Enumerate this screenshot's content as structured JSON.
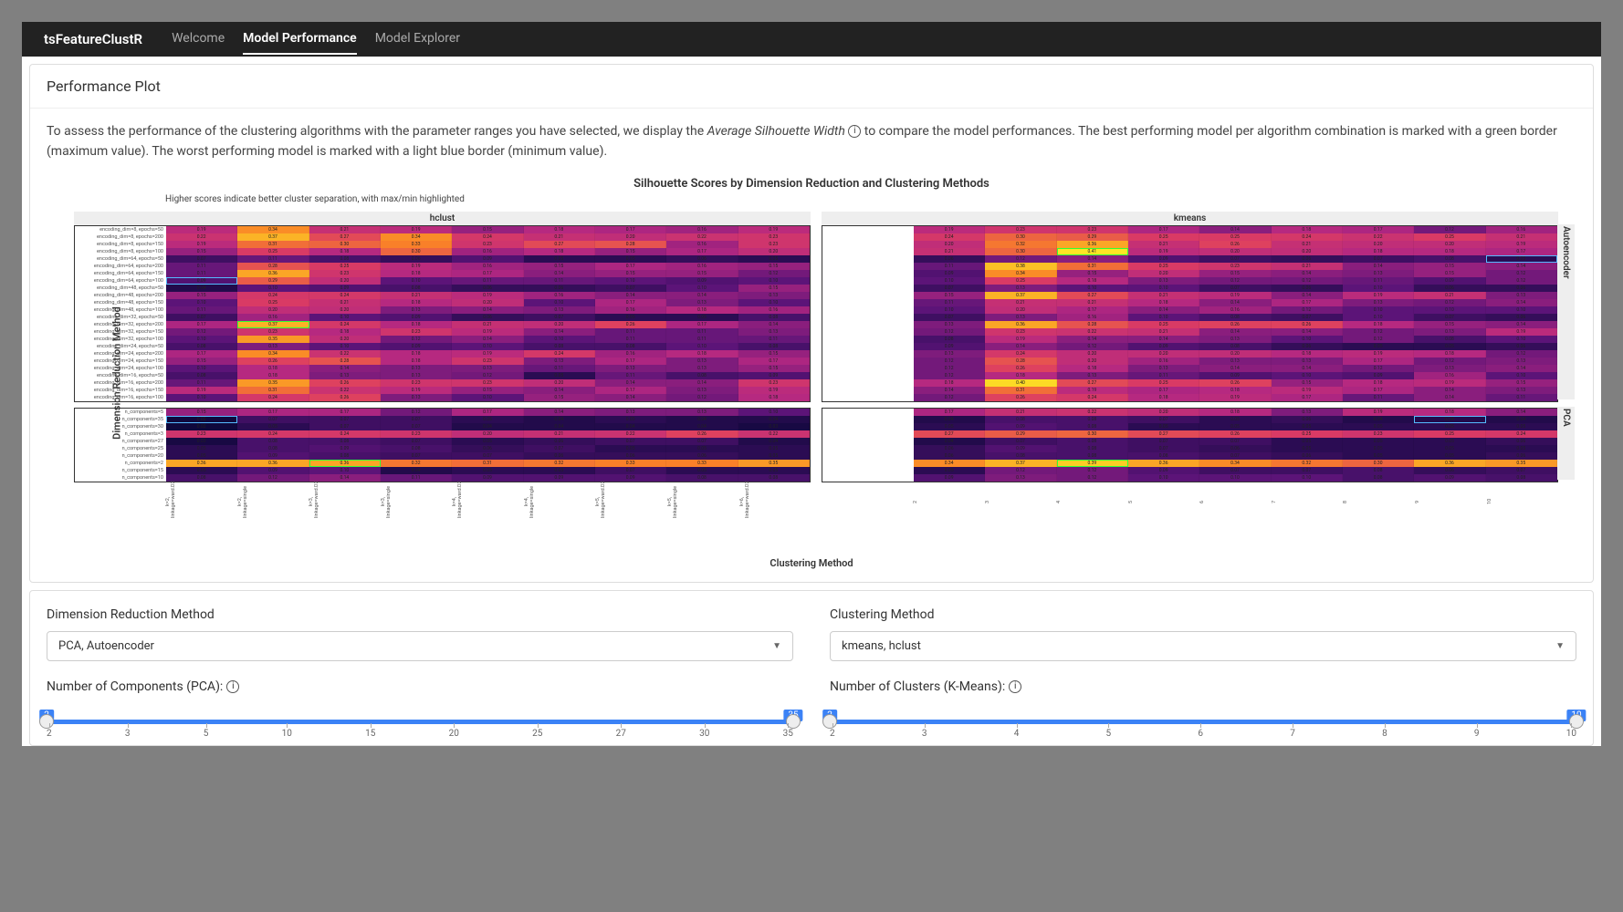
{
  "brand": "tsFeatureClustR",
  "nav": {
    "items": [
      "Welcome",
      "Model Performance",
      "Model Explorer"
    ],
    "active": 1
  },
  "panel": {
    "title": "Performance Plot",
    "desc_pre": "To assess the performance of the clustering algorithms with the parameter ranges you have selected, we display the ",
    "desc_em": "Average Silhouette Width",
    "desc_post": " to compare the model performances. The best performing model per algorithm combination is marked with a green border (maximum value). The worst performing model is marked with a light blue border (minimum value)."
  },
  "chart_data": {
    "type": "heatmap",
    "title": "Silhouette Scores by Dimension Reduction and Clustering Methods",
    "subtitle": "Higher scores indicate better cluster separation, with max/min highlighted",
    "ylabel": "Dimension Reduction Method",
    "xlabel": "Clustering Method",
    "col_facets": [
      "hclust",
      "kmeans"
    ],
    "row_facets": [
      "Autoencoder",
      "PCA"
    ],
    "x_ticks": [
      "k=2, linkage=ward.D2",
      "k=2, linkage=single",
      "k=3, linkage=ward.D2",
      "k=3, linkage=single",
      "k=4, linkage=ward.D2",
      "k=4, linkage=single",
      "k=5, linkage=ward.D2",
      "k=5, linkage=single",
      "k=6, linkage=ward.D2"
    ],
    "k_ticks": [
      "2",
      "3",
      "4",
      "5",
      "6",
      "7",
      "8",
      "9",
      "10"
    ],
    "autoencoder_rows": [
      "encoding_dim=8, epochs=50",
      "encoding_dim=8, epochs=200",
      "encoding_dim=8, epochs=150",
      "encoding_dim=8, epochs=100",
      "encoding_dim=64, epochs=50",
      "encoding_dim=64, epochs=200",
      "encoding_dim=64, epochs=150",
      "encoding_dim=64, epochs=100",
      "encoding_dim=48, epochs=50",
      "encoding_dim=48, epochs=200",
      "encoding_dim=48, epochs=150",
      "encoding_dim=48, epochs=100",
      "encoding_dim=32, epochs=50",
      "encoding_dim=32, epochs=200",
      "encoding_dim=32, epochs=150",
      "encoding_dim=32, epochs=100",
      "encoding_dim=24, epochs=50",
      "encoding_dim=24, epochs=200",
      "encoding_dim=24, epochs=150",
      "encoding_dim=24, epochs=100",
      "encoding_dim=16, epochs=50",
      "encoding_dim=16, epochs=200",
      "encoding_dim=16, epochs=150",
      "encoding_dim=16, epochs=100"
    ],
    "pca_rows": [
      "n_components=5",
      "n_components=35",
      "n_components=30",
      "n_components=3",
      "n_components=27",
      "n_components=25",
      "n_components=20",
      "n_components=2",
      "n_components=15",
      "n_components=10"
    ],
    "auto_hclust": [
      [
        0.19,
        0.34,
        0.21,
        0.19,
        0.15,
        0.18,
        0.17,
        0.16,
        0.19
      ],
      [
        0.22,
        0.37,
        0.27,
        0.34,
        0.24,
        0.21,
        0.2,
        0.22,
        0.23
      ],
      [
        0.19,
        0.31,
        0.3,
        0.33,
        0.23,
        0.27,
        0.28,
        0.16,
        0.23
      ],
      [
        0.15,
        0.25,
        0.18,
        0.3,
        0.16,
        0.18,
        0.15,
        0.17,
        0.2
      ],
      [
        0.07,
        0.11,
        0.08,
        0.06,
        0.09,
        0.05,
        0.05,
        0.06,
        0.05
      ],
      [
        0.11,
        0.28,
        0.25,
        0.19,
        0.16,
        0.15,
        0.17,
        0.16,
        0.15
      ],
      [
        0.11,
        0.36,
        0.23,
        0.18,
        0.17,
        0.14,
        0.15,
        0.15,
        0.12
      ],
      [
        0.09,
        0.29,
        0.2,
        0.1,
        0.11,
        0.11,
        0.1,
        0.09,
        0.1
      ],
      [
        0.04,
        0.1,
        0.09,
        0.08,
        0.06,
        0.06,
        0.07,
        0.1,
        0.15
      ],
      [
        0.15,
        0.24,
        0.24,
        0.21,
        0.19,
        0.16,
        0.14,
        0.14,
        0.13
      ],
      [
        0.1,
        0.25,
        0.21,
        0.18,
        0.2,
        0.1,
        0.17,
        0.13,
        0.1
      ],
      [
        0.11,
        0.2,
        0.2,
        0.13,
        0.14,
        0.13,
        0.16,
        0.18,
        0.16
      ],
      [
        0.07,
        0.16,
        0.1,
        0.09,
        0.06,
        0.07,
        0.05,
        0.05,
        0.08
      ],
      [
        0.17,
        0.37,
        0.24,
        0.18,
        0.21,
        0.2,
        0.26,
        0.17,
        0.14
      ],
      [
        0.12,
        0.23,
        0.18,
        0.23,
        0.19,
        0.14,
        0.11,
        0.11,
        0.13
      ],
      [
        0.1,
        0.35,
        0.2,
        0.12,
        0.14,
        0.1,
        0.11,
        0.11,
        0.11
      ],
      [
        0.08,
        0.13,
        0.1,
        0.09,
        0.1,
        0.08,
        0.08,
        0.1,
        0.08
      ],
      [
        0.17,
        0.34,
        0.22,
        0.18,
        0.19,
        0.24,
        0.16,
        0.18,
        0.15
      ],
      [
        0.15,
        0.26,
        0.28,
        0.18,
        0.23,
        0.13,
        0.17,
        0.13,
        0.17
      ],
      [
        0.1,
        0.18,
        0.14,
        0.13,
        0.13,
        0.11,
        0.13,
        0.13,
        0.15
      ],
      [
        0.08,
        0.18,
        0.13,
        0.13,
        0.12,
        0.05,
        0.11,
        0.08,
        0.09
      ],
      [
        0.11,
        0.35,
        0.26,
        0.23,
        0.23,
        0.2,
        0.14,
        0.14,
        0.23
      ],
      [
        0.19,
        0.31,
        0.22,
        0.19,
        0.15,
        0.14,
        0.17,
        0.13,
        0.19
      ],
      [
        0.1,
        0.24,
        0.26,
        0.13,
        0.1,
        0.15,
        0.14,
        0.12,
        0.18
      ]
    ],
    "auto_kmeans": [
      [
        0.19,
        0.23,
        0.23,
        0.17,
        0.14,
        0.18,
        0.17,
        0.12,
        0.16
      ],
      [
        0.24,
        0.3,
        0.29,
        0.25,
        0.25,
        0.24,
        0.22,
        0.25,
        0.21
      ],
      [
        0.2,
        0.32,
        0.36,
        0.21,
        0.26,
        0.21,
        0.2,
        0.2,
        0.19
      ],
      [
        0.21,
        0.3,
        0.41,
        0.19,
        0.2,
        0.2,
        0.18,
        0.18,
        0.17
      ],
      [
        0.06,
        0.12,
        0.14,
        0.09,
        0.07,
        0.06,
        0.07,
        0.08,
        0.05
      ],
      [
        0.11,
        0.38,
        0.31,
        0.25,
        0.23,
        0.21,
        0.14,
        0.15,
        0.14
      ],
      [
        0.09,
        0.34,
        0.15,
        0.2,
        0.15,
        0.14,
        0.13,
        0.15,
        0.12
      ],
      [
        0.1,
        0.25,
        0.18,
        0.13,
        0.12,
        0.12,
        0.11,
        0.09,
        0.12
      ],
      [
        0.07,
        0.13,
        0.1,
        0.1,
        0.07,
        0.06,
        0.1,
        0.06,
        0.06
      ],
      [
        0.15,
        0.37,
        0.27,
        0.21,
        0.19,
        0.14,
        0.19,
        0.21,
        0.13
      ],
      [
        0.11,
        0.21,
        0.21,
        0.18,
        0.14,
        0.17,
        0.13,
        0.12,
        0.14
      ],
      [
        0.1,
        0.2,
        0.17,
        0.14,
        0.16,
        0.12,
        0.1,
        0.1,
        0.1
      ],
      [
        0.07,
        0.13,
        0.16,
        0.1,
        0.08,
        0.07,
        0.1,
        0.07,
        0.06
      ],
      [
        0.13,
        0.36,
        0.28,
        0.25,
        0.26,
        0.26,
        0.18,
        0.15,
        0.14
      ],
      [
        0.12,
        0.23,
        0.22,
        0.21,
        0.14,
        0.14,
        0.12,
        0.13,
        0.19
      ],
      [
        0.08,
        0.19,
        0.14,
        0.14,
        0.13,
        0.1,
        0.12,
        0.08,
        0.1
      ],
      [
        0.09,
        0.14,
        0.12,
        0.09,
        0.08,
        0.06,
        0.05,
        0.05,
        0.06
      ],
      [
        0.13,
        0.24,
        0.2,
        0.2,
        0.2,
        0.18,
        0.19,
        0.18,
        0.12
      ],
      [
        0.12,
        0.28,
        0.2,
        0.16,
        0.13,
        0.13,
        0.17,
        0.12,
        0.13
      ],
      [
        0.12,
        0.26,
        0.18,
        0.13,
        0.14,
        0.14,
        0.12,
        0.13,
        0.14
      ],
      [
        0.12,
        0.18,
        0.13,
        0.11,
        0.09,
        0.1,
        0.09,
        0.16,
        0.1
      ],
      [
        0.18,
        0.4,
        0.27,
        0.25,
        0.26,
        0.15,
        0.18,
        0.19,
        0.15
      ],
      [
        0.14,
        0.31,
        0.19,
        0.17,
        0.18,
        0.19,
        0.17,
        0.14,
        0.13
      ],
      [
        0.12,
        0.26,
        0.24,
        0.18,
        0.19,
        0.17,
        0.11,
        0.14,
        0.11
      ]
    ],
    "pca_hclust": [
      [
        0.15,
        0.17,
        0.17,
        0.12,
        0.17,
        0.14,
        0.13,
        0.13,
        0.1
      ],
      [
        0.02,
        0.07,
        0.07,
        0.07,
        0.05,
        0.04,
        0.05,
        0.04,
        0.04
      ],
      [
        0.02,
        0.05,
        0.07,
        0.07,
        0.04,
        0.04,
        0.04,
        0.04,
        0.03
      ],
      [
        0.23,
        0.24,
        0.24,
        0.23,
        0.2,
        0.21,
        0.22,
        0.26,
        0.22
      ],
      [
        0.03,
        0.08,
        0.08,
        0.07,
        0.05,
        0.06,
        0.07,
        0.07,
        0.04
      ],
      [
        0.05,
        0.08,
        0.09,
        0.08,
        0.06,
        0.07,
        0.05,
        0.05,
        0.05
      ],
      [
        0.05,
        0.09,
        0.08,
        0.07,
        0.07,
        0.06,
        0.06,
        0.06,
        0.05
      ],
      [
        0.36,
        0.36,
        0.36,
        0.32,
        0.31,
        0.32,
        0.33,
        0.33,
        0.35
      ],
      [
        0.05,
        0.09,
        0.1,
        0.04,
        0.05,
        0.05,
        0.07,
        0.05,
        0.05
      ],
      [
        0.08,
        0.12,
        0.14,
        0.11,
        0.09,
        0.09,
        0.09,
        0.08,
        0.08
      ]
    ],
    "pca_kmeans": [
      [
        0.17,
        0.21,
        0.22,
        0.2,
        0.18,
        0.13,
        0.19,
        0.18,
        0.14
      ],
      [
        0.04,
        0.08,
        0.08,
        0.07,
        0.05,
        0.06,
        0.04,
        0.04,
        0.04
      ],
      [
        0.05,
        0.09,
        0.08,
        0.05,
        0.05,
        0.05,
        0.05,
        0.05,
        0.05
      ],
      [
        0.27,
        0.29,
        0.3,
        0.27,
        0.26,
        0.25,
        0.23,
        0.25,
        0.24
      ],
      [
        0.04,
        0.07,
        0.08,
        0.07,
        0.07,
        0.05,
        0.05,
        0.05,
        0.06
      ],
      [
        0.06,
        0.09,
        0.08,
        0.07,
        0.06,
        0.05,
        0.05,
        0.05,
        0.05
      ],
      [
        0.06,
        0.08,
        0.08,
        0.08,
        0.07,
        0.06,
        0.05,
        0.05,
        0.06
      ],
      [
        0.34,
        0.37,
        0.39,
        0.36,
        0.34,
        0.32,
        0.3,
        0.36,
        0.35
      ],
      [
        0.05,
        0.12,
        0.12,
        0.09,
        0.07,
        0.07,
        0.08,
        0.06,
        0.07
      ],
      [
        0.09,
        0.13,
        0.12,
        0.1,
        0.1,
        0.1,
        0.08,
        0.09,
        0.08
      ]
    ],
    "auto_hclust_max": [
      13,
      1
    ],
    "auto_hclust_min": [
      7,
      0
    ],
    "auto_kmeans_max": [
      3,
      2
    ],
    "auto_kmeans_min": [
      4,
      8
    ],
    "pca_hclust_max": [
      7,
      2
    ],
    "pca_hclust_min": [
      1,
      0
    ],
    "pca_kmeans_max": [
      7,
      2
    ],
    "pca_kmeans_min": [
      1,
      7
    ]
  },
  "controls": {
    "dim_label": "Dimension Reduction Method",
    "dim_value": "PCA, Autoencoder",
    "clu_label": "Clustering Method",
    "clu_value": "kmeans, hclust",
    "pca_label": "Number of Components (PCA):",
    "pca_min": 2,
    "pca_max": 35,
    "pca_ticks": [
      2,
      3,
      5,
      10,
      15,
      20,
      25,
      27,
      30,
      35
    ],
    "k_label": "Number of Clusters (K-Means):",
    "k_min": 2,
    "k_max": 10,
    "k_ticks": [
      2,
      3,
      4,
      5,
      6,
      7,
      8,
      9,
      10
    ]
  }
}
